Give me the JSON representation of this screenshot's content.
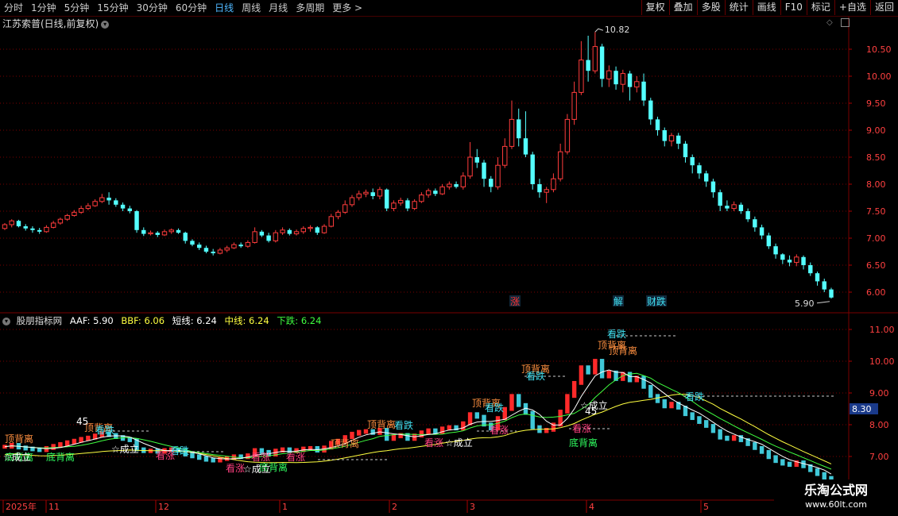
{
  "toolbar": {
    "periods": [
      "分时",
      "1分钟",
      "5分钟",
      "15分钟",
      "30分钟",
      "60分钟",
      "日线",
      "周线",
      "月线",
      "多周期",
      "更多 >"
    ],
    "active_period": "日线",
    "right_buttons": [
      "复权",
      "叠加",
      "多股",
      "统计",
      "画线",
      "F10",
      "标记",
      "+自选",
      "返回"
    ]
  },
  "main_panel": {
    "title": "江苏索普(日线,前复权)",
    "y_ticks": [
      "10.50",
      "10.00",
      "9.50",
      "9.00",
      "8.50",
      "8.00",
      "7.50",
      "7.00",
      "6.50",
      "6.00"
    ],
    "high_label": "10.82",
    "last_label": "5.90",
    "event_labels": [
      {
        "text": "涨",
        "color": "#ff3030"
      },
      {
        "text": "解",
        "color": "#40e0f0"
      },
      {
        "text": "财",
        "color": "#40e0f0"
      },
      {
        "text": "跌",
        "color": "#40e0f0"
      }
    ]
  },
  "indicator_panel": {
    "name": "股朋指标网",
    "aaf_label": "AAF:",
    "aaf_value": "5.90",
    "bbf_label": "BBF:",
    "bbf_value": "6.06",
    "short_label": "短线:",
    "short_value": "6.24",
    "mid_label": "中线:",
    "mid_value": "6.24",
    "down_label": "下跌:",
    "down_value": "6.24",
    "y_ticks": [
      "11.00",
      "10.00",
      "9.00",
      "8.00",
      "7.00"
    ],
    "current_value": "8.30",
    "annotations": [
      {
        "text": "顶背离",
        "color": "#ff9040"
      },
      {
        "text": "顶背离",
        "color": "#ff9040"
      },
      {
        "text": "顶背离",
        "color": "#ff9040"
      },
      {
        "text": "顶背离",
        "color": "#ff9040"
      },
      {
        "text": "顶背离",
        "color": "#ff9040"
      },
      {
        "text": "顶背离",
        "color": "#ff9040"
      },
      {
        "text": "顶背离",
        "color": "#ff9040"
      },
      {
        "text": "顶背离",
        "color": "#ff9040"
      },
      {
        "text": "底背离",
        "color": "#30ff60"
      },
      {
        "text": "底背离",
        "color": "#30ff60"
      },
      {
        "text": "底背离",
        "color": "#30ff60"
      },
      {
        "text": "底背离",
        "color": "#30ff60"
      },
      {
        "text": "看跌",
        "color": "#40e0f0"
      },
      {
        "text": "看跌",
        "color": "#40e0f0"
      },
      {
        "text": "看跌",
        "color": "#40e0f0"
      },
      {
        "text": "看跌",
        "color": "#40e0f0"
      },
      {
        "text": "看跌",
        "color": "#40e0f0"
      },
      {
        "text": "看跌",
        "color": "#40e0f0"
      },
      {
        "text": "看跌",
        "color": "#40e0f0"
      },
      {
        "text": "看涨",
        "color": "#ff4080"
      },
      {
        "text": "看涨",
        "color": "#ff4080"
      },
      {
        "text": "看涨",
        "color": "#ff4080"
      },
      {
        "text": "看涨",
        "color": "#ff4080"
      },
      {
        "text": "看涨",
        "color": "#ff4080"
      },
      {
        "text": "看涨",
        "color": "#ff4080"
      },
      {
        "text": "看涨",
        "color": "#ff4080"
      },
      {
        "text": "☆成立",
        "color": "#ffffff"
      },
      {
        "text": "☆成立",
        "color": "#ffffff"
      },
      {
        "text": "☆成立",
        "color": "#ffffff"
      },
      {
        "text": "☆成立",
        "color": "#ffffff"
      },
      {
        "text": "☆成立",
        "color": "#ffffff"
      },
      {
        "text": "45",
        "color": "#ffffff"
      },
      {
        "text": "45",
        "color": "#ffffff"
      }
    ]
  },
  "x_axis": {
    "labels": [
      "2025年",
      "11",
      "12",
      "1",
      "2",
      "3",
      "4",
      "5"
    ]
  },
  "watermark": {
    "line1": "乐淘公式网",
    "line2": "www.60lt.com"
  },
  "colors": {
    "up": "#ff3c3c",
    "down": "#54ffff",
    "grid": "#7a0000",
    "short_line": "#ffffff",
    "mid_line": "#ffff40",
    "down_line": "#40ff40"
  },
  "chart_data": {
    "type": "candlestick",
    "ylim": [
      5.7,
      10.95
    ],
    "x_labels": [
      "2025年",
      "11",
      "12",
      "1",
      "2",
      "3",
      "4",
      "5"
    ],
    "candles": [
      [
        7.18,
        7.25,
        7.28,
        7.15
      ],
      [
        7.25,
        7.32,
        7.35,
        7.2
      ],
      [
        7.32,
        7.22,
        7.34,
        7.2
      ],
      [
        7.22,
        7.18,
        7.26,
        7.14
      ],
      [
        7.18,
        7.15,
        7.22,
        7.1
      ],
      [
        7.15,
        7.12,
        7.19,
        7.08
      ],
      [
        7.12,
        7.2,
        7.24,
        7.1
      ],
      [
        7.2,
        7.28,
        7.32,
        7.18
      ],
      [
        7.28,
        7.35,
        7.38,
        7.25
      ],
      [
        7.35,
        7.42,
        7.45,
        7.32
      ],
      [
        7.42,
        7.48,
        7.52,
        7.4
      ],
      [
        7.48,
        7.55,
        7.6,
        7.45
      ],
      [
        7.55,
        7.6,
        7.65,
        7.52
      ],
      [
        7.6,
        7.68,
        7.72,
        7.58
      ],
      [
        7.68,
        7.75,
        7.82,
        7.65
      ],
      [
        7.75,
        7.7,
        7.85,
        7.62
      ],
      [
        7.7,
        7.62,
        7.74,
        7.58
      ],
      [
        7.62,
        7.55,
        7.66,
        7.5
      ],
      [
        7.55,
        7.5,
        7.6,
        7.46
      ],
      [
        7.5,
        7.15,
        7.52,
        7.1
      ],
      [
        7.15,
        7.08,
        7.2,
        7.04
      ],
      [
        7.08,
        7.1,
        7.14,
        7.05
      ],
      [
        7.1,
        7.06,
        7.13,
        7.02
      ],
      [
        7.06,
        7.12,
        7.16,
        7.04
      ],
      [
        7.12,
        7.15,
        7.18,
        7.08
      ],
      [
        7.15,
        7.1,
        7.18,
        7.08
      ],
      [
        7.1,
        6.95,
        7.12,
        6.9
      ],
      [
        6.95,
        6.88,
        6.98,
        6.85
      ],
      [
        6.88,
        6.82,
        6.92,
        6.78
      ],
      [
        6.82,
        6.75,
        6.86,
        6.72
      ],
      [
        6.75,
        6.72,
        6.8,
        6.68
      ],
      [
        6.72,
        6.78,
        6.82,
        6.7
      ],
      [
        6.78,
        6.82,
        6.86,
        6.74
      ],
      [
        6.82,
        6.88,
        6.92,
        6.8
      ],
      [
        6.88,
        6.85,
        6.92,
        6.82
      ],
      [
        6.85,
        6.92,
        6.96,
        6.82
      ],
      [
        6.92,
        7.12,
        7.2,
        6.9
      ],
      [
        7.12,
        7.05,
        7.15,
        7.02
      ],
      [
        7.05,
        6.95,
        7.1,
        6.92
      ],
      [
        6.95,
        7.1,
        7.15,
        6.92
      ],
      [
        7.1,
        7.15,
        7.2,
        7.06
      ],
      [
        7.15,
        7.08,
        7.18,
        7.05
      ],
      [
        7.08,
        7.12,
        7.16,
        7.05
      ],
      [
        7.12,
        7.18,
        7.22,
        7.08
      ],
      [
        7.18,
        7.2,
        7.24,
        7.12
      ],
      [
        7.2,
        7.1,
        7.22,
        7.06
      ],
      [
        7.1,
        7.22,
        7.26,
        7.08
      ],
      [
        7.22,
        7.4,
        7.45,
        7.2
      ],
      [
        7.4,
        7.48,
        7.52,
        7.35
      ],
      [
        7.48,
        7.62,
        7.7,
        7.45
      ],
      [
        7.62,
        7.75,
        7.8,
        7.58
      ],
      [
        7.75,
        7.82,
        7.88,
        7.7
      ],
      [
        7.82,
        7.85,
        7.9,
        7.76
      ],
      [
        7.85,
        7.78,
        7.92,
        7.72
      ],
      [
        7.78,
        7.9,
        7.95,
        7.72
      ],
      [
        7.9,
        7.55,
        7.92,
        7.5
      ],
      [
        7.55,
        7.65,
        7.7,
        7.5
      ],
      [
        7.65,
        7.7,
        7.75,
        7.6
      ],
      [
        7.7,
        7.55,
        7.74,
        7.5
      ],
      [
        7.55,
        7.68,
        7.72,
        7.52
      ],
      [
        7.68,
        7.8,
        7.85,
        7.65
      ],
      [
        7.8,
        7.88,
        7.92,
        7.75
      ],
      [
        7.88,
        7.82,
        7.92,
        7.78
      ],
      [
        7.82,
        7.95,
        8.0,
        7.8
      ],
      [
        7.95,
        8.0,
        8.05,
        7.9
      ],
      [
        8.0,
        7.95,
        8.05,
        7.92
      ],
      [
        7.95,
        8.15,
        8.22,
        7.9
      ],
      [
        8.15,
        8.5,
        8.78,
        8.1
      ],
      [
        8.5,
        8.4,
        8.65,
        8.3
      ],
      [
        8.4,
        8.1,
        8.45,
        7.95
      ],
      [
        8.1,
        7.95,
        8.15,
        7.85
      ],
      [
        7.95,
        8.35,
        8.5,
        7.9
      ],
      [
        8.35,
        8.7,
        8.85,
        8.3
      ],
      [
        8.7,
        9.2,
        9.55,
        8.65
      ],
      [
        9.2,
        8.85,
        9.4,
        8.7
      ],
      [
        8.85,
        8.55,
        9.35,
        8.5
      ],
      [
        8.55,
        8.0,
        8.6,
        7.9
      ],
      [
        8.0,
        7.85,
        8.1,
        7.75
      ],
      [
        7.85,
        7.9,
        7.95,
        7.65
      ],
      [
        7.9,
        8.1,
        8.2,
        7.85
      ],
      [
        8.1,
        8.6,
        8.75,
        8.05
      ],
      [
        8.6,
        9.2,
        9.3,
        8.55
      ],
      [
        9.2,
        9.7,
        9.9,
        9.1
      ],
      [
        9.7,
        10.3,
        10.65,
        9.65
      ],
      [
        10.3,
        10.1,
        10.75,
        9.9
      ],
      [
        10.1,
        10.55,
        10.82,
        10.05
      ],
      [
        10.55,
        9.95,
        10.6,
        9.8
      ],
      [
        9.95,
        10.1,
        10.2,
        9.8
      ],
      [
        10.1,
        9.85,
        10.18,
        9.75
      ],
      [
        9.85,
        10.05,
        10.12,
        9.7
      ],
      [
        10.05,
        9.8,
        10.1,
        9.55
      ],
      [
        9.8,
        9.9,
        10.0,
        9.7
      ],
      [
        9.9,
        9.55,
        10.05,
        9.45
      ],
      [
        9.55,
        9.2,
        9.6,
        9.1
      ],
      [
        9.2,
        9.0,
        9.25,
        8.9
      ],
      [
        9.0,
        8.8,
        9.05,
        8.7
      ],
      [
        8.8,
        8.9,
        8.95,
        8.7
      ],
      [
        8.9,
        8.75,
        8.95,
        8.65
      ],
      [
        8.75,
        8.5,
        8.8,
        8.4
      ],
      [
        8.5,
        8.35,
        8.55,
        8.2
      ],
      [
        8.35,
        8.2,
        8.4,
        8.1
      ],
      [
        8.2,
        8.05,
        8.25,
        7.95
      ],
      [
        8.05,
        7.85,
        8.1,
        7.75
      ],
      [
        7.85,
        7.6,
        7.9,
        7.5
      ],
      [
        7.6,
        7.55,
        7.7,
        7.5
      ],
      [
        7.55,
        7.62,
        7.68,
        7.5
      ],
      [
        7.62,
        7.5,
        7.66,
        7.45
      ],
      [
        7.5,
        7.35,
        7.55,
        7.3
      ],
      [
        7.35,
        7.2,
        7.4,
        7.12
      ],
      [
        7.2,
        7.05,
        7.25,
        6.98
      ],
      [
        7.05,
        6.85,
        7.1,
        6.8
      ],
      [
        6.85,
        6.7,
        6.9,
        6.62
      ],
      [
        6.7,
        6.6,
        6.72,
        6.52
      ],
      [
        6.6,
        6.55,
        6.68,
        6.48
      ],
      [
        6.55,
        6.65,
        6.7,
        6.48
      ],
      [
        6.65,
        6.5,
        6.68,
        6.42
      ],
      [
        6.5,
        6.35,
        6.55,
        6.3
      ],
      [
        6.35,
        6.2,
        6.38,
        6.12
      ],
      [
        6.2,
        6.05,
        6.25,
        6.0
      ],
      [
        6.05,
        5.9,
        6.08,
        5.88
      ]
    ]
  }
}
